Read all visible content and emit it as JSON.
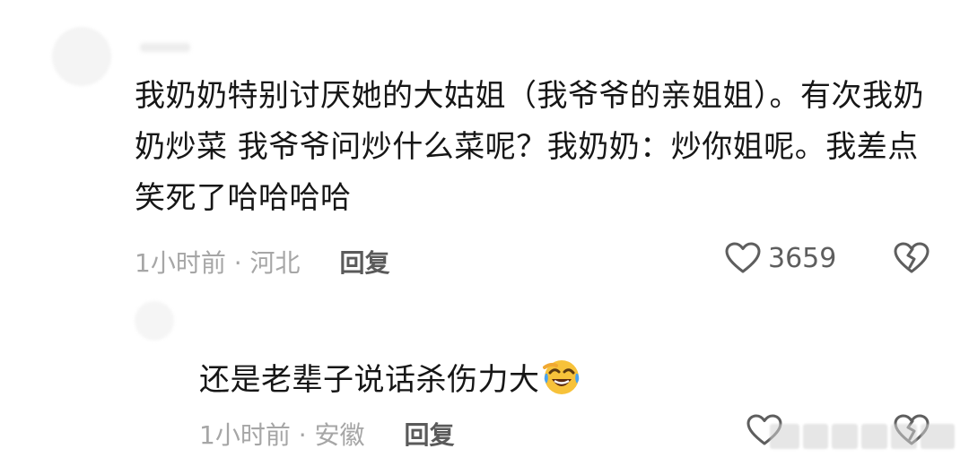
{
  "comments": [
    {
      "text": "我奶奶特别讨厌她的大姑姐（我爷爷的亲姐姐）。有次我奶奶炒菜 我爷爷问炒什么菜呢？我奶奶：炒你姐呢。我差点笑死了哈哈哈哈",
      "meta": "1小时前 · 河北",
      "reply_label": "回复",
      "likes": "3659",
      "like_icon": "heart-outline-icon",
      "dislike_icon": "broken-heart-icon"
    },
    {
      "text": "还是老辈子说话杀伤力大",
      "emoji": "crying-laughing-emoji",
      "meta": "1小时前 · 安徽",
      "reply_label": "回复",
      "like_icon": "heart-outline-icon",
      "dislike_icon": "broken-heart-icon"
    }
  ],
  "colors": {
    "text": "#161616",
    "meta": "#a6a6a6",
    "reply": "#5a5a5a",
    "icon": "#5e5e5e",
    "background": "#ffffff"
  }
}
